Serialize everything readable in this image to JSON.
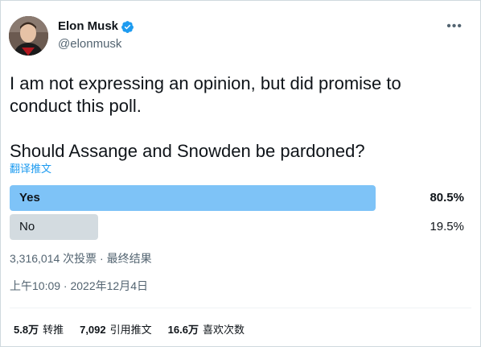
{
  "author": {
    "name": "Elon Musk",
    "handle": "@elonmusk"
  },
  "tweet": {
    "text": "I am not expressing an opinion, but did promise to\nconduct this poll.\n\nShould Assange and Snowden be pardoned?",
    "translate_label": "翻译推文"
  },
  "poll": {
    "options": [
      {
        "label": "Yes",
        "percent_text": "80.5%",
        "fraction": 0.805,
        "winner": true
      },
      {
        "label": "No",
        "percent_text": "19.5%",
        "fraction": 0.195,
        "winner": false
      }
    ],
    "meta": "3,316,014 次投票 · 最终结果"
  },
  "timestamp": "上午10:09 · 2022年12月4日",
  "stats": {
    "retweets_num": "5.8万",
    "retweets_label": "转推",
    "quotes_num": "7,092",
    "quotes_label": "引用推文",
    "likes_num": "16.6万",
    "likes_label": "喜欢次数"
  },
  "icons": {
    "verified": "verified-badge-icon",
    "more": "more-icon",
    "avatar": "avatar"
  },
  "colors": {
    "accent": "#1d9bf0",
    "winner_bar": "#7ec3f7",
    "loser_bar": "#d3dbe0",
    "secondary_text": "#536471"
  }
}
